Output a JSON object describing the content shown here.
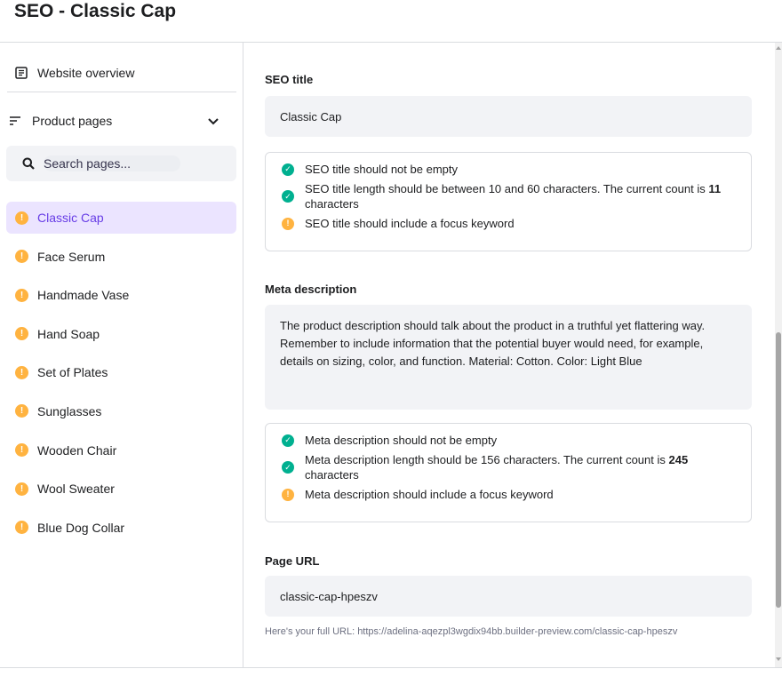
{
  "header": {
    "title": "SEO - Classic Cap"
  },
  "sidebar": {
    "overview_label": "Website overview",
    "dropdown_label": "Product pages",
    "search_placeholder": "Search pages...",
    "pages": [
      {
        "label": "Classic Cap",
        "active": true
      },
      {
        "label": "Face Serum"
      },
      {
        "label": "Handmade Vase"
      },
      {
        "label": "Hand Soap"
      },
      {
        "label": "Set of Plates"
      },
      {
        "label": "Sunglasses"
      },
      {
        "label": "Wooden Chair"
      },
      {
        "label": "Wool Sweater"
      },
      {
        "label": "Blue Dog Collar"
      }
    ]
  },
  "seo_title": {
    "label": "SEO title",
    "value": "Classic Cap",
    "checks": {
      "not_empty": "SEO title should not be empty",
      "length_pre": "SEO title length should be between 10 and 60 characters. The current count is ",
      "length_count": "11",
      "length_post": " characters",
      "keyword": "SEO title should include a focus keyword"
    }
  },
  "meta_description": {
    "label": "Meta description",
    "value": "The product description should talk about the product in a truthful yet flattering way. Remember to include information that the potential buyer would need, for example, details on sizing, color, and function. Material: Cotton. Color: Light Blue",
    "checks": {
      "not_empty": "Meta description should not be empty",
      "length_pre": "Meta description length should be 156 characters. The current count is ",
      "length_count": "245",
      "length_post": " characters",
      "keyword": "Meta description should include a focus keyword"
    }
  },
  "page_url": {
    "label": "Page URL",
    "value": "classic-cap-hpeszv",
    "hint": "Here's your full URL: https://adelina-aqezpl3wgdix94bb.builder-preview.com/classic-cap-hpeszv"
  },
  "colors": {
    "accent": "#673de6",
    "ok": "#00b090",
    "warn": "#ffb340"
  }
}
